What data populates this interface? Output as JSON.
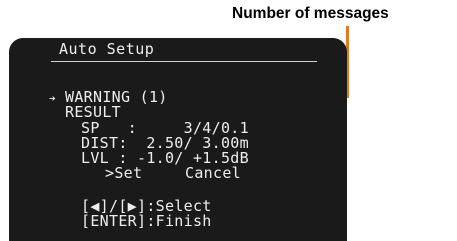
{
  "callout": {
    "label": "Number of messages",
    "color": "#e07a1f"
  },
  "screen": {
    "title": "Auto Setup",
    "cursor_icon": "right-arrow-icon",
    "warning": "WARNING (1)",
    "result": "RESULT",
    "sp": "SP   :     3/4/0.1",
    "dist": "DIST:  2.50/ 3.00m",
    "lvl": "LVL : -1.0/ +1.5dB",
    "set": ">Set",
    "cancel": "Cancel",
    "select_hint": "[◀]/[▶]:Select",
    "finish_hint": "[ENTER]:Finish"
  }
}
